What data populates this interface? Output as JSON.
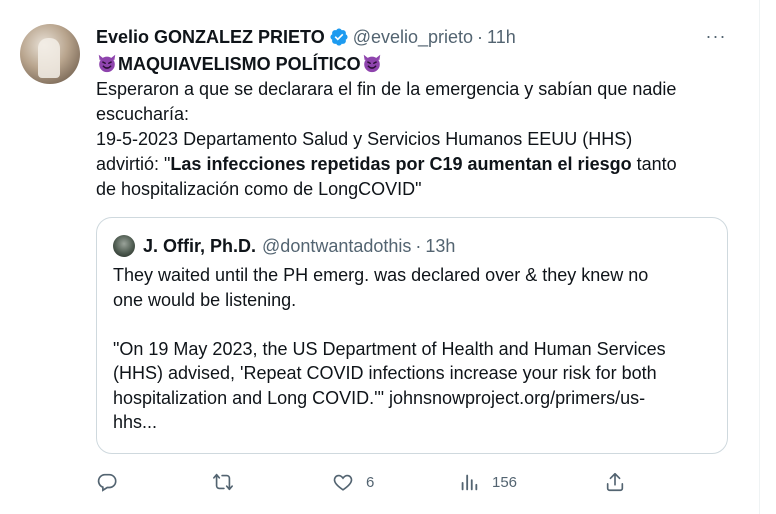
{
  "tweet": {
    "author_name": "Evelio GONZALEZ PRIETO",
    "author_handle": "@evelio_prieto",
    "separator": "·",
    "time": "11h",
    "more_label": "···",
    "title": "MAQUIAVELISMO POLÍTICO",
    "line1": "Esperaron a que se declarara el fin de la emergencia y sabían que nadie",
    "line2": "escucharía:",
    "line3": "19-5-2023 Departamento Salud y Servicios Humanos EEUU (HHS)",
    "line4_pre": "advirtió: \"",
    "line4_bold": "Las infecciones repetidas por C19 aumentan el riesgo",
    "line4_post": " tanto",
    "line5": "de hospitalización como de LongCOVID\""
  },
  "quote": {
    "author_name": "J. Offir, Ph.D.",
    "author_handle": "@dontwantadothis",
    "separator": "·",
    "time": "13h",
    "l1": "They waited until the PH emerg. was declared over & they knew no",
    "l2": "one would be listening.",
    "l3": "\"On 19 May 2023, the US Department of Health and Human Services",
    "l4": "(HHS) advised, 'Repeat COVID infections increase your risk for both",
    "l5": "hospitalization and Long COVID.'\" johnsnowproject.org/primers/us-",
    "l6": "hhs..."
  },
  "actions": {
    "likes": "6",
    "views": "156"
  },
  "colors": {
    "text": "#0f1419",
    "secondary": "#536471",
    "verified": "#1d9bf0",
    "border": "#cfd9de",
    "devil": "#8e44ad"
  },
  "icons": [
    "verified-badge-icon",
    "smiling-devil-emoji-icon",
    "reply-icon",
    "retweet-icon",
    "like-icon",
    "views-icon",
    "share-icon"
  ]
}
